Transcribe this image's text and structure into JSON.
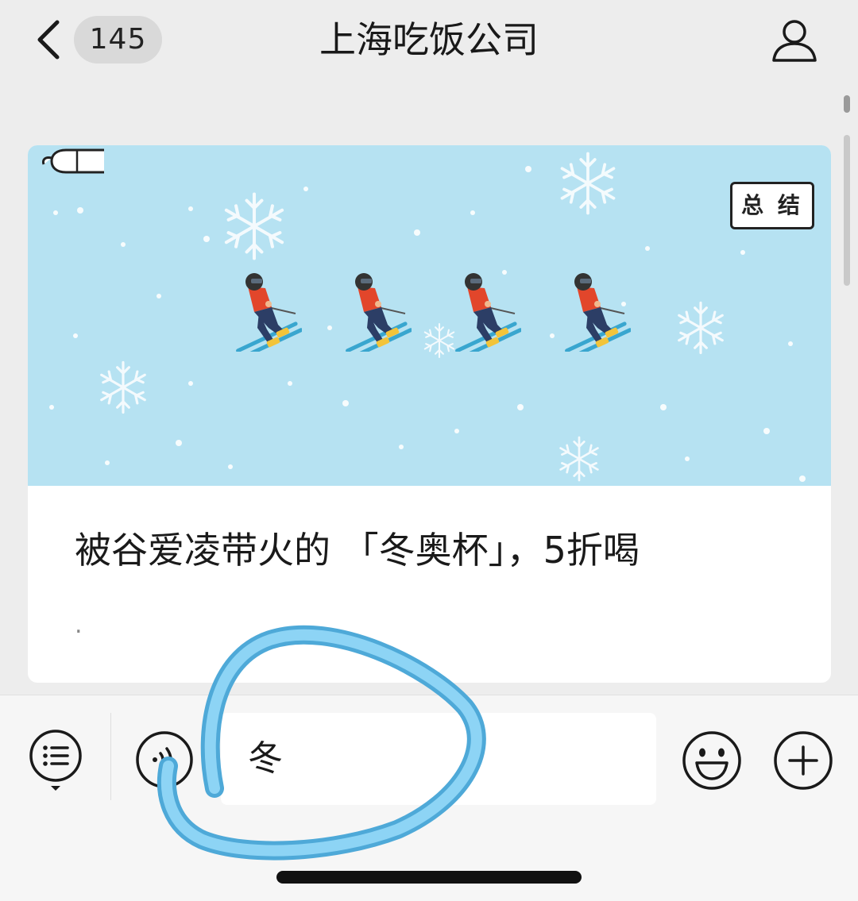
{
  "header": {
    "back_icon": "chevron-left-icon",
    "unread_count": "145",
    "title": "上海吃饭公司",
    "profile_icon": "person-outline-icon"
  },
  "article": {
    "cover_tag": "总 结",
    "title": "被谷爱凌带火的 「冬奥杯」，5折喝",
    "description": "."
  },
  "input_bar": {
    "menu_icon": "list-menu-icon",
    "voice_icon": "voice-wave-icon",
    "input_value": "冬",
    "emoji_icon": "smiley-icon",
    "add_icon": "plus-circle-icon"
  },
  "colors": {
    "page_bg": "#ededed",
    "cover_bg": "#b6e2f2",
    "annotation_stroke": "#6cc3ec",
    "title_text": "#191919"
  }
}
